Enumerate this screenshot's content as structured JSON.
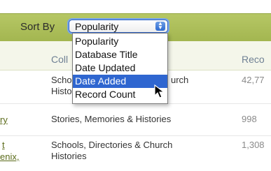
{
  "sort": {
    "label": "Sort By",
    "selected_value": "Popularity",
    "options": [
      "Popularity",
      "Database Title",
      "Date Updated",
      "Date Added",
      "Record Count"
    ],
    "highlighted_option": "Date Added"
  },
  "table": {
    "headers": {
      "collection": "Coll",
      "records": "Reco"
    },
    "rows": [
      {
        "link_text": "",
        "category_line1": "Scho",
        "category_line1_right": "urch",
        "category_line2": "Histo",
        "count": "42,77"
      },
      {
        "link_text": "ry",
        "category_line1": "Stories, Memories & Histories",
        "category_line2": "",
        "count": "998"
      },
      {
        "link_text_line1": "t",
        "link_text_line2": "enix,",
        "category_line1": "Schools, Directories & Church",
        "category_line2": "Histories",
        "count": "1,308"
      }
    ]
  },
  "colors": {
    "sortbar": "#a9bb57",
    "highlight": "#2f66d0",
    "header_text": "#6f8094",
    "link": "#5b6b1a"
  },
  "icons": {
    "select_arrows": "up-down-chevron-icon",
    "pointer": "arrow-cursor-icon"
  }
}
